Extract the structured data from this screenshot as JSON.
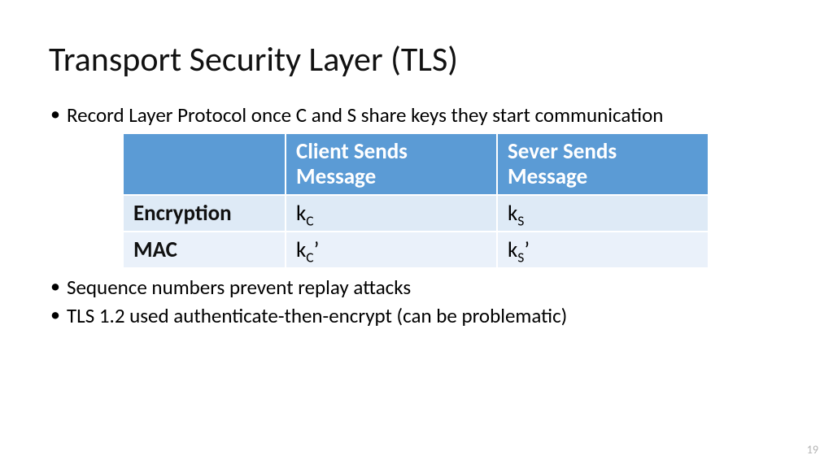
{
  "title": "Transport Security Layer (TLS)",
  "bullets": {
    "b1": "Record Layer Protocol once C and S share keys they start communication",
    "b2": "Sequence numbers prevent replay attacks",
    "b3": "TLS 1.2 used authenticate-then-encrypt (can be problematic)"
  },
  "table": {
    "head": {
      "c0": "",
      "c1": "Client Sends Message",
      "c2": "Sever Sends Message"
    },
    "rows": [
      {
        "label": "Encryption",
        "c1_base": "k",
        "c1_sub": "C",
        "c1_suffix": "",
        "c2_base": "k",
        "c2_sub": "S",
        "c2_suffix": ""
      },
      {
        "label": "MAC",
        "c1_base": "k",
        "c1_sub": "C",
        "c1_suffix": "’",
        "c2_base": "k",
        "c2_sub": "S",
        "c2_suffix": "’"
      }
    ]
  },
  "page_number": "19"
}
